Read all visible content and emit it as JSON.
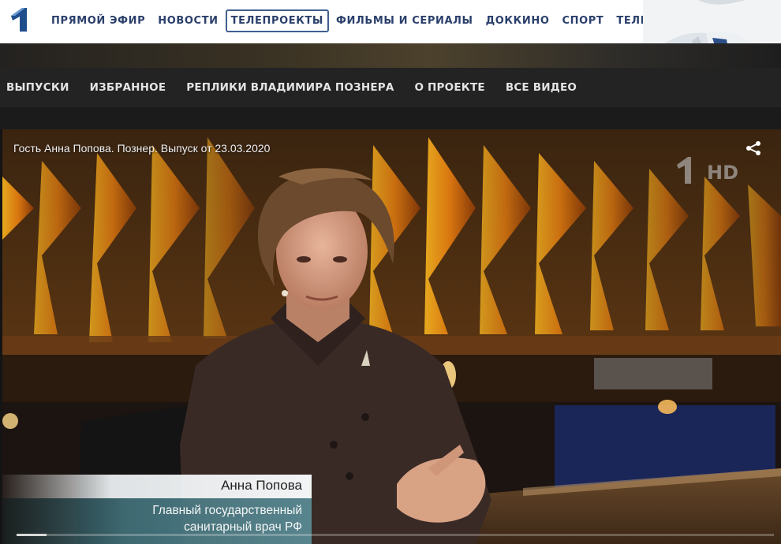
{
  "header": {
    "nav": [
      {
        "label": "ПРЯМОЙ ЭФИР",
        "active": false
      },
      {
        "label": "НОВОСТИ",
        "active": false
      },
      {
        "label": "ТЕЛЕПРОЕКТЫ",
        "active": true
      },
      {
        "label": "ФИЛЬМЫ И СЕРИАЛЫ",
        "active": false
      },
      {
        "label": "ДОККИНО",
        "active": false
      },
      {
        "label": "СПОРТ",
        "active": false
      },
      {
        "label": "ТЕЛЕПРОГРАММА",
        "active": false
      }
    ],
    "logo_icon": "channel-one-logo-icon",
    "brand_color": "#2a3f6b"
  },
  "section_nav": {
    "items": [
      "ВЫПУСКИ",
      "ИЗБРАННОЕ",
      "РЕПЛИКИ ВЛАДИМИРА ПОЗНЕРА",
      "О ПРОЕКТЕ",
      "ВСЕ ВИДЕО"
    ]
  },
  "player": {
    "title": "Гость Анна Попова. Познер. Выпуск от 23.03.2020",
    "share_icon": "share-icon",
    "channel_bug": "HD",
    "lower_third": {
      "name": "Анна Попова",
      "role_line1": "Главный государственный",
      "role_line2": "санитарный врач РФ"
    },
    "progress": 0.04
  }
}
